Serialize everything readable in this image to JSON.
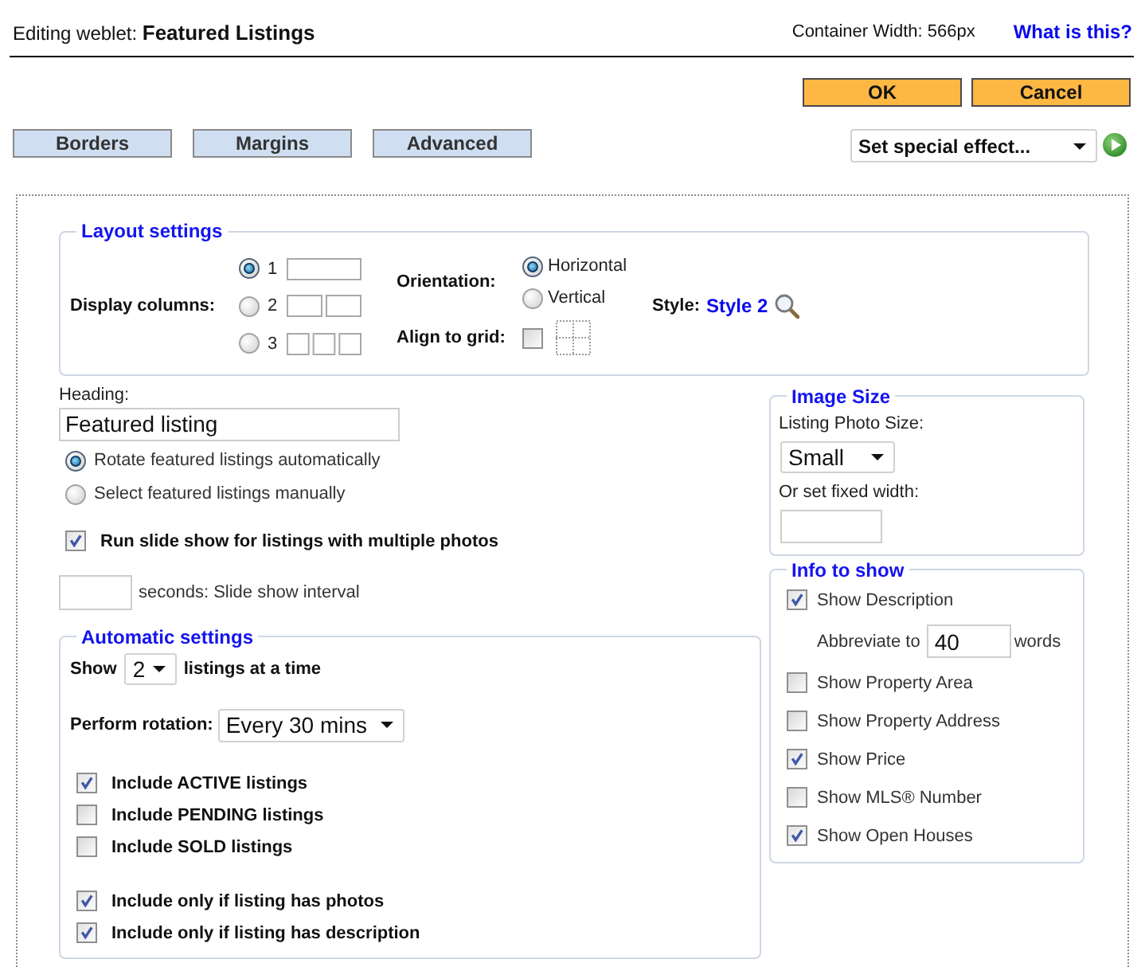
{
  "header": {
    "title": "Editing weblet: **Featured Listings**",
    "container_width": "Container Width: 566px",
    "help_link": "What is this?"
  },
  "dialog_buttons": [
    {
      "label": "OK"
    },
    {
      "label": "Cancel"
    }
  ],
  "section_buttons": [
    {
      "label": "Borders"
    },
    {
      "label": "Margins"
    },
    {
      "label": "Advanced"
    }
  ],
  "special_effect": {
    "value": "Set special effect..."
  },
  "layout_settings": {
    "legend": "Layout settings",
    "display_columns": {
      "label": "Display columns:",
      "options": [
        {
          "label": "1",
          "selected": true
        },
        {
          "label": "2",
          "selected": false
        },
        {
          "label": "3",
          "selected": false
        }
      ]
    },
    "orientation": {
      "label": "Orientation:",
      "options": [
        {
          "label": "Horizontal",
          "selected": true
        },
        {
          "label": "Vertical",
          "selected": false
        }
      ]
    },
    "align_to_grid": {
      "label": "Align to grid:",
      "checked": false
    },
    "style": {
      "label": "Style:",
      "value": "Style 2"
    }
  },
  "heading": {
    "label": "Heading:",
    "value": "Featured listing"
  },
  "selection_mode": [
    {
      "label": "Rotate featured listings automatically",
      "selected": true
    },
    {
      "label": "Select featured listings manually",
      "selected": false
    }
  ],
  "slide_show": {
    "label": "Run slide show for listings with multiple photos",
    "checked": true
  },
  "slide_interval": {
    "label": "seconds: Slide show interval"
  },
  "automatic_settings": {
    "legend": "Automatic settings",
    "show_count": {
      "prefix": "Show",
      "value": "2",
      "suffix": "listings at a time"
    },
    "rotation": {
      "label": "Perform rotation:",
      "value": "Every 30 mins"
    },
    "status_filters": [
      {
        "label": "Include ACTIVE listings",
        "checked": true
      },
      {
        "label": "Include PENDING listings",
        "checked": false
      },
      {
        "label": "Include SOLD listings",
        "checked": false
      }
    ],
    "requirements": [
      {
        "label": "Include only if listing has photos",
        "checked": true
      },
      {
        "label": "Include only if listing has description",
        "checked": true
      }
    ]
  },
  "image_size": {
    "legend": "Image Size",
    "photo_size_label": "Listing Photo Size:",
    "photo_size": "Small",
    "fixed_width_label": "Or set fixed width:"
  },
  "info_to_show": {
    "legend": "Info to show",
    "items": [
      {
        "kind": "checkbox",
        "label": "Show Description",
        "checked": true
      },
      {
        "kind": "number",
        "prefix": "Abbreviate to",
        "value": "40",
        "suffix": "words"
      },
      {
        "kind": "checkbox",
        "label": "Show Property Area",
        "checked": false
      },
      {
        "kind": "checkbox",
        "label": "Show Property Address",
        "checked": false
      },
      {
        "kind": "checkbox",
        "label": "Show Price",
        "checked": true
      },
      {
        "kind": "checkbox",
        "label": "Show MLS® Number",
        "checked": false
      },
      {
        "kind": "checkbox",
        "label": "Show Open Houses",
        "checked": true
      }
    ]
  }
}
